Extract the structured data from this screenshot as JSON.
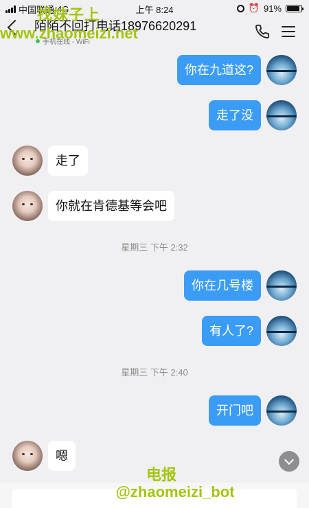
{
  "status_bar": {
    "carrier": "中国联通",
    "network": "4G",
    "time": "上午 8:24",
    "battery": "91%",
    "battery_level": 0.91
  },
  "header": {
    "title": "陌陌不回打电话18976620291",
    "subtitle": "手机在线 - WiFi"
  },
  "watermark": {
    "top_line1": "找妹子上",
    "top_line2": "www.zhaomeizi.net",
    "bottom_line1": "电报",
    "bottom_line2": "@zhaomeizi_bot"
  },
  "messages": [
    {
      "from": "me",
      "text": "你在九道这?"
    },
    {
      "from": "me",
      "text": "走了没"
    },
    {
      "from": "her",
      "text": "走了"
    },
    {
      "from": "her",
      "text": "你就在肯德基等会吧"
    },
    {
      "type": "time",
      "text": "星期三 下午 2:32"
    },
    {
      "from": "me",
      "text": "你在几号楼"
    },
    {
      "from": "me",
      "text": "有人了?"
    },
    {
      "type": "time",
      "text": "星期三 下午 2:40"
    },
    {
      "from": "me",
      "text": "开门吧"
    },
    {
      "from": "her",
      "text": "嗯"
    }
  ],
  "icons": {
    "back": "chevron-left-icon",
    "phone": "phone-icon",
    "menu": "hamburger-menu-icon",
    "scroll": "chevron-down-icon"
  },
  "colors": {
    "my_bubble": "#3b9cf6",
    "her_bubble": "#ffffff",
    "background": "#f0f0f2",
    "watermark": "#a3c40e"
  }
}
